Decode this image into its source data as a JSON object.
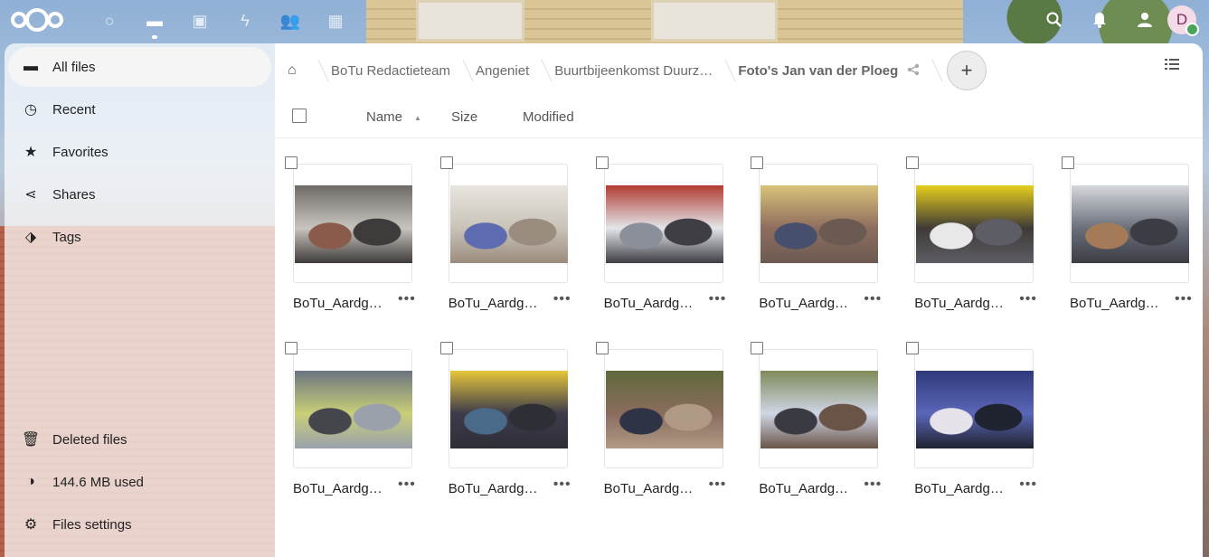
{
  "header": {
    "apps": [
      {
        "name": "dashboard-icon",
        "glyph": "○",
        "active": false
      },
      {
        "name": "files-icon",
        "glyph": "▬",
        "active": true
      },
      {
        "name": "photos-icon",
        "glyph": "▣",
        "active": false
      },
      {
        "name": "activity-icon",
        "glyph": "ϟ",
        "active": false
      },
      {
        "name": "contacts-icon",
        "glyph": "👥",
        "active": false
      },
      {
        "name": "calendar-icon",
        "glyph": "▦",
        "active": false
      }
    ],
    "avatar_letter": "D"
  },
  "sidebar": {
    "items": [
      {
        "label": "All files",
        "icon": "folder-icon",
        "glyph": "▬",
        "active": true
      },
      {
        "label": "Recent",
        "icon": "clock-icon",
        "glyph": "◷",
        "active": false
      },
      {
        "label": "Favorites",
        "icon": "star-icon",
        "glyph": "★",
        "active": false
      },
      {
        "label": "Shares",
        "icon": "share-icon",
        "glyph": "⋖",
        "active": false
      },
      {
        "label": "Tags",
        "icon": "tag-icon",
        "glyph": "⬗",
        "active": false
      }
    ],
    "bottom": [
      {
        "label": "Deleted files",
        "icon": "trash-icon",
        "glyph": "🗑"
      },
      {
        "label": "144.6 MB used",
        "icon": "pie-chart-icon",
        "glyph": "◑"
      },
      {
        "label": "Files settings",
        "icon": "gear-icon",
        "glyph": "⚙"
      }
    ]
  },
  "breadcrumb": {
    "items": [
      "BoTu Redactieteam",
      "Angeniet",
      "Buurtbijeenkomst Duurz…"
    ],
    "current": "Foto's Jan van der Ploeg",
    "add_label": "+"
  },
  "columns": {
    "name": "Name",
    "size": "Size",
    "modified": "Modified"
  },
  "files": [
    {
      "name": "BoTu_Aardg…",
      "colors": [
        "#6e6a66",
        "#c8c4bf",
        "#8a5a4a",
        "#3e3b3a"
      ]
    },
    {
      "name": "BoTu_Aardg…",
      "colors": [
        "#e9e6df",
        "#c9c3b8",
        "#5d6bb0",
        "#9a8c7e"
      ]
    },
    {
      "name": "BoTu_Aardg…",
      "colors": [
        "#b23b32",
        "#e3e6ea",
        "#8a8f99",
        "#3e3e44"
      ]
    },
    {
      "name": "BoTu_Aardg…",
      "colors": [
        "#d9c37a",
        "#8e6d5e",
        "#46506c",
        "#6b5a52"
      ]
    },
    {
      "name": "BoTu_Aardg…",
      "colors": [
        "#e6cf1c",
        "#3f3a36",
        "#e8e8e8",
        "#5d5d66"
      ]
    },
    {
      "name": "BoTu_Aardg…",
      "colors": [
        "#d5d8dc",
        "#6a6f7a",
        "#a47a58",
        "#3c3c44"
      ]
    },
    {
      "name": "BoTu_Aardg…",
      "colors": [
        "#6b7480",
        "#c9cf78",
        "#44464c",
        "#9aa1ab"
      ]
    },
    {
      "name": "BoTu_Aardg…",
      "colors": [
        "#e7c63a",
        "#3d3b4a",
        "#4a6a8a",
        "#2e2e36"
      ]
    },
    {
      "name": "BoTu_Aardg…",
      "colors": [
        "#5f6a3d",
        "#8a6c5e",
        "#2e3446",
        "#b09a86"
      ]
    },
    {
      "name": "BoTu_Aardg…",
      "colors": [
        "#7f8a5a",
        "#cfd6e6",
        "#3a3a42",
        "#6a5448"
      ]
    },
    {
      "name": "BoTu_Aardg…",
      "colors": [
        "#2f3a7a",
        "#5a66b8",
        "#e7e3ea",
        "#1f2330"
      ]
    }
  ]
}
